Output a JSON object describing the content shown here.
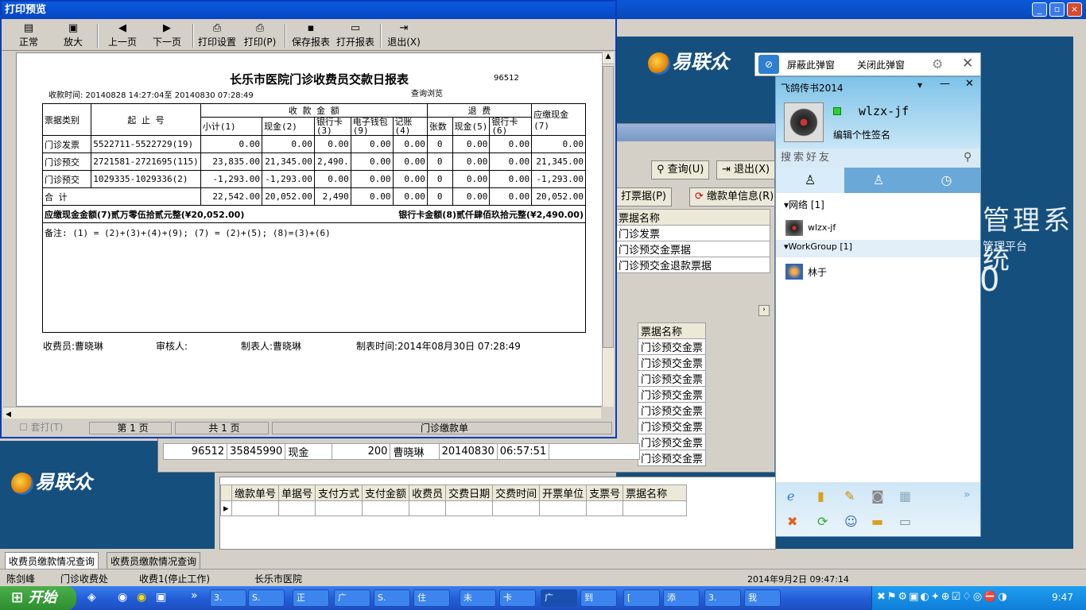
{
  "print_preview": {
    "title": "打印预览",
    "toolbar": [
      {
        "label": "正常",
        "icon": "▤"
      },
      {
        "label": "放大",
        "icon": "▣"
      },
      {
        "label": "上一页",
        "icon": "◀"
      },
      {
        "label": "下一页",
        "icon": "▶"
      },
      {
        "label": "打印设置",
        "icon": "⎙"
      },
      {
        "label": "打印(P)",
        "icon": "⎙"
      },
      {
        "label": "保存报表",
        "icon": "▪"
      },
      {
        "label": "打开报表",
        "icon": "▭"
      },
      {
        "label": "退出(X)",
        "icon": "⇥"
      }
    ],
    "status": {
      "multi_print": "套打(T)",
      "page": "第 1 页",
      "total": "共 1 页",
      "doc": "门诊缴款单"
    }
  },
  "report": {
    "title": "长乐市医院门诊收费员交款日报表",
    "code": "96512",
    "time_label": "收款时间: 20140828 14:27:04至 20140830 07:28:49",
    "query_label": "查询浏览",
    "headers": {
      "type": "票据类别",
      "range": "起  止  号",
      "income": "收  款  金  额",
      "refund": "退  费",
      "due": "应缴现金(7)",
      "subtotal": "小计(1)",
      "cash": "现金(2)",
      "card": "银行卡(3)",
      "ewallet": "电子钱包(9)",
      "account": "记账(4)",
      "count": "张数",
      "rcash": "现金(5)",
      "rcard": "银行卡(6)"
    },
    "rows": [
      [
        "门诊发票",
        "5522711-5522729(19)",
        "0.00",
        "0.00",
        "0.00",
        "0.00",
        "0.00",
        "0",
        "0.00",
        "0.00",
        "0.00"
      ],
      [
        "门诊预交",
        "2721581-2721695(115)",
        "23,835.00",
        "21,345.00",
        "2,490.",
        "0.00",
        "0.00",
        "0",
        "0.00",
        "0.00",
        "21,345.00"
      ],
      [
        "门诊预交",
        "1029335-1029336(2)",
        "-1,293.00",
        "-1,293.00",
        "0.00",
        "0.00",
        "0.00",
        "0",
        "0.00",
        "0.00",
        "-1,293.00"
      ],
      [
        "合          计",
        "",
        "22,542.00",
        "20,052.00",
        "2,490",
        "0.00",
        "0.00",
        "0",
        "0.00",
        "0.00",
        "20,052.00"
      ]
    ],
    "due_cash": "应缴现金金额(7)贰万零伍拾贰元整(¥20,052.00)",
    "card_amount": "银行卡金额(8)贰仟肆佰玖拾元整(¥2,490.00)",
    "note": "备注: (1) = (2)+(3)+(4)+(9); (7) = (2)+(5); (8)=(3)+(6)",
    "footer": {
      "collector": "收费员:曹晓琳",
      "auditor": "审核人:",
      "maker": "制表人:曹晓琳",
      "made_time": "制表时间:2014年08月30日  07:28:49"
    }
  },
  "background": {
    "logo": "易联众",
    "system_title": "管理系统",
    "platform": "管理平台",
    "digit": "0",
    "query_buttons": [
      "查询(U)",
      "退出(X)",
      "打票据(P)",
      "缴款单信息(R)"
    ],
    "grid1_header": "票据名称",
    "grid1_rows": [
      "门诊发票",
      "门诊预交金票据",
      "门诊预交金退款票据"
    ],
    "grid2_header": "票据名称",
    "grid2_rows": [
      "门诊预交金票",
      "门诊预交金票",
      "门诊预交金票",
      "门诊预交金票",
      "门诊预交金票",
      "门诊预交金票",
      "门诊预交金票",
      "门诊预交金票"
    ],
    "grid2_last": [
      "96512",
      "35845990",
      "现金",
      "200",
      "曹晓琳",
      "20140830",
      "06:57:51"
    ],
    "grid3_headers": [
      "缴款单号",
      "单据号",
      "支付方式",
      "支付金额",
      "收费员",
      "交费日期",
      "交费时间",
      "开票单位",
      "支票号",
      "票据名称"
    ],
    "tabs": [
      "收费员缴款情况查询",
      "收费员缴款情况查询"
    ],
    "status": [
      "陈剑峰",
      "门诊收费处",
      "收费1(停止工作)",
      "长乐市医院",
      "2014年9月2日 09:47:14"
    ]
  },
  "chat": {
    "popup_block": "屏蔽此弹窗",
    "popup_close": "关闭此弹窗",
    "app_title": "飞鸽传书2014",
    "username": "wlzx-jf",
    "signature": "编辑个性签名",
    "search_placeholder": "搜索好友",
    "group1": "网络 [1]",
    "group1_member": "wlzx-jf",
    "group2": "WorkGroup [1]",
    "group2_member": "林于"
  },
  "taskbar": {
    "start": "开始",
    "items": [
      "3.",
      "S.",
      "正",
      "广",
      "S.",
      "住",
      "未",
      "卡",
      "广",
      "到",
      "[",
      "添",
      "3.",
      "我"
    ],
    "clock": "9:47"
  }
}
